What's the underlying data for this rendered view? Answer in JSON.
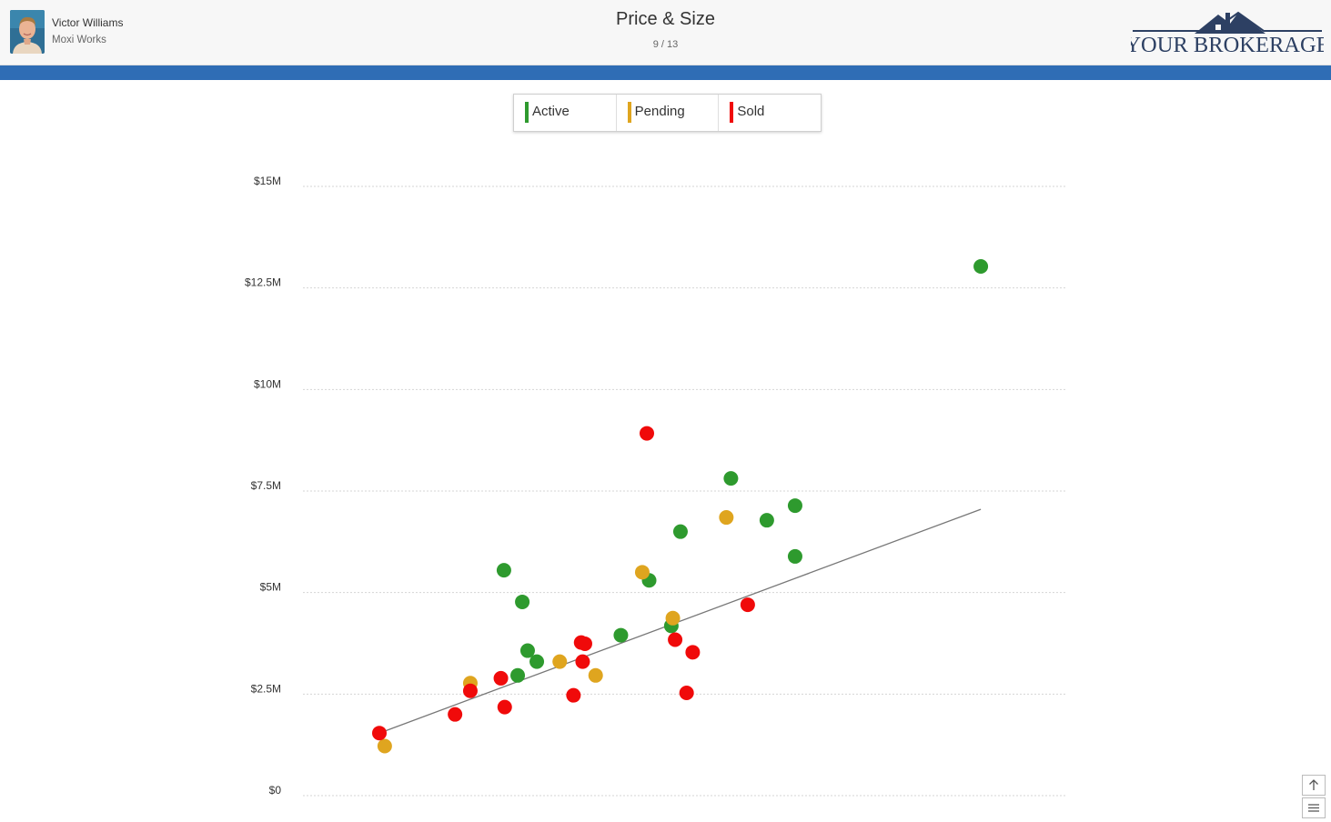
{
  "header": {
    "agent_name": "Victor Williams",
    "agent_company": "Moxi Works",
    "title": "Price & Size",
    "pager": "9 / 13",
    "logo_text": "YOUR BROKERAGE"
  },
  "legend": [
    {
      "label": "Active",
      "color": "#2e9a2e"
    },
    {
      "label": "Pending",
      "color": "#dfa51f"
    },
    {
      "label": "Sold",
      "color": "#f00a0a"
    }
  ],
  "colors": {
    "header_bg": "#f7f7f7",
    "accent_bar": "#2f6db5",
    "logo": "#2d4063",
    "trend_line": "#777777",
    "grid": "#d5d5d5"
  },
  "controls": {
    "scroll_top_icon": "arrow-up-icon",
    "menu_icon": "hamburger-menu-icon"
  },
  "chart_data": {
    "type": "scatter",
    "title": "",
    "xlabel": "",
    "ylabel": "",
    "ylim": [
      0,
      15000000
    ],
    "xlim": [
      0,
      100
    ],
    "y_ticks": [
      {
        "value": 0,
        "label": "$0"
      },
      {
        "value": 2500000,
        "label": "$2.5M"
      },
      {
        "value": 5000000,
        "label": "$5M"
      },
      {
        "value": 7500000,
        "label": "$7.5M"
      },
      {
        "value": 10000000,
        "label": "$10M"
      },
      {
        "value": 12500000,
        "label": "$12.5M"
      },
      {
        "value": 15000000,
        "label": "$15M"
      }
    ],
    "grid": true,
    "x_ticks_visible": false,
    "series": [
      {
        "name": "Active",
        "color": "#2e9a2e",
        "points": [
          {
            "x": 26.3,
            "y": 5550000
          },
          {
            "x": 28.7,
            "y": 4770000
          },
          {
            "x": 29.4,
            "y": 3570000
          },
          {
            "x": 28.1,
            "y": 2960000
          },
          {
            "x": 30.6,
            "y": 3300000
          },
          {
            "x": 41.6,
            "y": 3950000
          },
          {
            "x": 45.3,
            "y": 5300000
          },
          {
            "x": 48.2,
            "y": 4180000
          },
          {
            "x": 49.4,
            "y": 6500000
          },
          {
            "x": 56.0,
            "y": 7810000
          },
          {
            "x": 60.7,
            "y": 6780000
          },
          {
            "x": 64.4,
            "y": 7140000
          },
          {
            "x": 64.4,
            "y": 5890000
          },
          {
            "x": 88.7,
            "y": 13030000
          }
        ]
      },
      {
        "name": "Pending",
        "color": "#dfa51f",
        "points": [
          {
            "x": 10.7,
            "y": 1220000
          },
          {
            "x": 21.9,
            "y": 2770000
          },
          {
            "x": 33.6,
            "y": 3300000
          },
          {
            "x": 38.3,
            "y": 2960000
          },
          {
            "x": 44.4,
            "y": 5500000
          },
          {
            "x": 48.4,
            "y": 4370000
          },
          {
            "x": 55.4,
            "y": 6850000
          }
        ]
      },
      {
        "name": "Sold",
        "color": "#f00a0a",
        "points": [
          {
            "x": 10.0,
            "y": 1540000
          },
          {
            "x": 19.9,
            "y": 2000000
          },
          {
            "x": 21.9,
            "y": 2580000
          },
          {
            "x": 25.9,
            "y": 2890000
          },
          {
            "x": 26.4,
            "y": 2180000
          },
          {
            "x": 35.4,
            "y": 2470000
          },
          {
            "x": 36.4,
            "y": 3770000
          },
          {
            "x": 36.9,
            "y": 3740000
          },
          {
            "x": 36.6,
            "y": 3300000
          },
          {
            "x": 45.0,
            "y": 8920000
          },
          {
            "x": 48.7,
            "y": 3840000
          },
          {
            "x": 50.2,
            "y": 2530000
          },
          {
            "x": 51.0,
            "y": 3530000
          },
          {
            "x": 58.2,
            "y": 4700000
          }
        ]
      }
    ],
    "trend_line": {
      "x": [
        10.0,
        88.7
      ],
      "y": [
        1540000,
        7050000
      ]
    }
  }
}
